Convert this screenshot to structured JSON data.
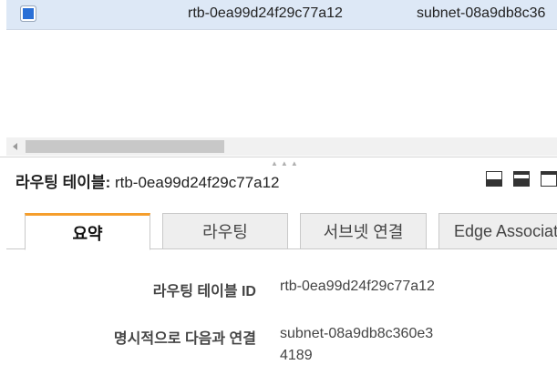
{
  "table": {
    "row": {
      "route_table_id": "rtb-0ea99d24f29c77a12",
      "subnet_id": "subnet-08a9db8c36"
    }
  },
  "details": {
    "title_label": "라우팅 테이블:",
    "title_value": "rtb-0ea99d24f29c77a12",
    "tabs": [
      {
        "label": "요약",
        "active": true
      },
      {
        "label": "라우팅",
        "active": false
      },
      {
        "label": "서브넷 연결",
        "active": false
      },
      {
        "label": "Edge Associati",
        "active": false
      }
    ],
    "summary": {
      "route_table_id_label": "라우팅 테이블 ID",
      "route_table_id_value": "rtb-0ea99d24f29c77a12",
      "explicit_assoc_label": "명시적으로 다음과 연결",
      "explicit_assoc_value": "subnet-08a9db8c360e34189"
    }
  },
  "colors": {
    "selected_row": "#dde8f6",
    "checkbox": "#2a6fd6",
    "active_tab_accent": "#f59e2c"
  },
  "icons": {
    "scroll_left": "triangle-left-icon",
    "layout_buttons": [
      "panel-bottom-icon",
      "panel-split-icon",
      "panel-top-icon"
    ]
  }
}
